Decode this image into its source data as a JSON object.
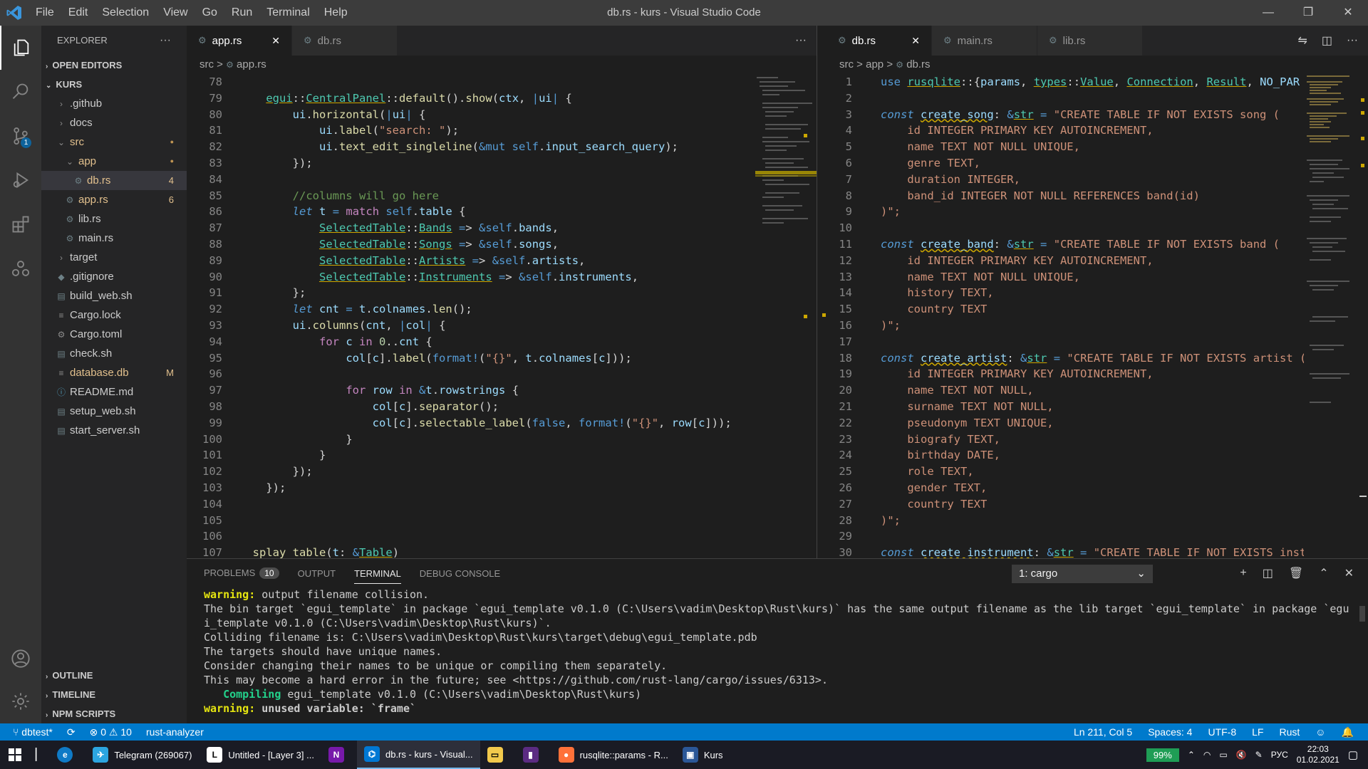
{
  "window": {
    "title": "db.rs - kurs - Visual Studio Code",
    "menu": [
      "File",
      "Edit",
      "Selection",
      "View",
      "Go",
      "Run",
      "Terminal",
      "Help"
    ],
    "controls": [
      "—",
      "❐",
      "✕"
    ]
  },
  "activity": {
    "scm_badge": "1"
  },
  "explorer": {
    "header": "EXPLORER",
    "more": "···",
    "sections": {
      "open_editors": "OPEN EDITORS",
      "root": "KURS",
      "outline": "OUTLINE",
      "timeline": "TIMELINE",
      "npm": "NPM SCRIPTS"
    },
    "items": [
      {
        "label": ".github",
        "indent": 1,
        "type": "folder-closed"
      },
      {
        "label": "docs",
        "indent": 1,
        "type": "folder-closed"
      },
      {
        "label": "src",
        "indent": 1,
        "type": "folder-open",
        "decoration": "●"
      },
      {
        "label": "app",
        "indent": 2,
        "type": "folder-open",
        "decoration": "●"
      },
      {
        "label": "db.rs",
        "indent": 3,
        "type": "rust",
        "decoration": "4",
        "selected": true
      },
      {
        "label": "app.rs",
        "indent": 2,
        "type": "rust",
        "decoration": "6"
      },
      {
        "label": "lib.rs",
        "indent": 2,
        "type": "rust"
      },
      {
        "label": "main.rs",
        "indent": 2,
        "type": "rust"
      },
      {
        "label": "target",
        "indent": 1,
        "type": "folder-closed"
      },
      {
        "label": ".gitignore",
        "indent": 1,
        "type": "git"
      },
      {
        "label": "build_web.sh",
        "indent": 1,
        "type": "file"
      },
      {
        "label": "Cargo.lock",
        "indent": 1,
        "type": "lines"
      },
      {
        "label": "Cargo.toml",
        "indent": 1,
        "type": "gear"
      },
      {
        "label": "check.sh",
        "indent": 1,
        "type": "file"
      },
      {
        "label": "database.db",
        "indent": 1,
        "type": "lines",
        "decoration": "M"
      },
      {
        "label": "README.md",
        "indent": 1,
        "type": "info"
      },
      {
        "label": "setup_web.sh",
        "indent": 1,
        "type": "file"
      },
      {
        "label": "start_server.sh",
        "indent": 1,
        "type": "file"
      }
    ]
  },
  "editor_left": {
    "tabs": [
      {
        "label": "app.rs",
        "close": "✕",
        "active": true
      },
      {
        "label": "db.rs",
        "close": "",
        "active": false
      }
    ],
    "more": "···",
    "breadcrumb": {
      "a": "src",
      "sep": ">",
      "b": "app.rs"
    },
    "lines": [
      {
        "n": "78",
        "code": ""
      },
      {
        "n": "79",
        "code": "    egui::CentralPanel::default().show(ctx, |ui| {"
      },
      {
        "n": "80",
        "code": "        ui.horizontal(|ui| {"
      },
      {
        "n": "81",
        "code": "            ui.label(\"search: \");"
      },
      {
        "n": "82",
        "code": "            ui.text_edit_singleline(&mut self.input_search_query);"
      },
      {
        "n": "83",
        "code": "        });"
      },
      {
        "n": "84",
        "code": ""
      },
      {
        "n": "85",
        "code": "        //columns will go here"
      },
      {
        "n": "86",
        "code": "        let t = match self.table {"
      },
      {
        "n": "87",
        "code": "            SelectedTable::Bands => &self.bands,"
      },
      {
        "n": "88",
        "code": "            SelectedTable::Songs => &self.songs,"
      },
      {
        "n": "89",
        "code": "            SelectedTable::Artists => &self.artists,"
      },
      {
        "n": "90",
        "code": "            SelectedTable::Instruments => &self.instruments,"
      },
      {
        "n": "91",
        "code": "        };"
      },
      {
        "n": "92",
        "code": "        let cnt = t.colnames.len();"
      },
      {
        "n": "93",
        "code": "        ui.columns(cnt, |col| {"
      },
      {
        "n": "94",
        "code": "            for c in 0..cnt {"
      },
      {
        "n": "95",
        "code": "                col[c].label(format!(\"{}\", t.colnames[c]));"
      },
      {
        "n": "96",
        "code": ""
      },
      {
        "n": "97",
        "code": "                for row in &t.rowstrings {"
      },
      {
        "n": "98",
        "code": "                    col[c].separator();"
      },
      {
        "n": "99",
        "code": "                    col[c].selectable_label(false, format!(\"{}\", row[c]));"
      },
      {
        "n": "100",
        "code": "                }"
      },
      {
        "n": "101",
        "code": "            }"
      },
      {
        "n": "102",
        "code": "        });"
      },
      {
        "n": "103",
        "code": "    });"
      },
      {
        "n": "104",
        "code": ""
      },
      {
        "n": "105",
        "code": ""
      },
      {
        "n": "106",
        "code": ""
      },
      {
        "n": "107",
        "code": "  splay_table(t: &Table)"
      }
    ]
  },
  "editor_right": {
    "tabs": [
      {
        "label": "db.rs",
        "close": "✕",
        "active": true
      },
      {
        "label": "main.rs",
        "close": "",
        "active": false
      },
      {
        "label": "lib.rs",
        "close": "",
        "active": false
      }
    ],
    "breadcrumb": {
      "a": "src",
      "sep": ">",
      "b": "app",
      "c": "db.rs"
    },
    "lines": [
      {
        "n": "1",
        "code": "use rusqlite::{params, types::Value, Connection, Result, NO_PAR"
      },
      {
        "n": "2",
        "code": ""
      },
      {
        "n": "3",
        "code": "const create_song: &str = \"CREATE TABLE IF NOT EXISTS song ("
      },
      {
        "n": "4",
        "code": "    id INTEGER PRIMARY KEY AUTOINCREMENT,"
      },
      {
        "n": "5",
        "code": "    name TEXT NOT NULL UNIQUE,"
      },
      {
        "n": "6",
        "code": "    genre TEXT,"
      },
      {
        "n": "7",
        "code": "    duration INTEGER,"
      },
      {
        "n": "8",
        "code": "    band_id INTEGER NOT NULL REFERENCES band(id)"
      },
      {
        "n": "9",
        "code": ")\";"
      },
      {
        "n": "10",
        "code": ""
      },
      {
        "n": "11",
        "code": "const create_band: &str = \"CREATE TABLE IF NOT EXISTS band ("
      },
      {
        "n": "12",
        "code": "    id INTEGER PRIMARY KEY AUTOINCREMENT,"
      },
      {
        "n": "13",
        "code": "    name TEXT NOT NULL UNIQUE,"
      },
      {
        "n": "14",
        "code": "    history TEXT,"
      },
      {
        "n": "15",
        "code": "    country TEXT"
      },
      {
        "n": "16",
        "code": ")\";"
      },
      {
        "n": "17",
        "code": ""
      },
      {
        "n": "18",
        "code": "const create_artist: &str = \"CREATE TABLE IF NOT EXISTS artist ("
      },
      {
        "n": "19",
        "code": "    id INTEGER PRIMARY KEY AUTOINCREMENT,"
      },
      {
        "n": "20",
        "code": "    name TEXT NOT NULL,"
      },
      {
        "n": "21",
        "code": "    surname TEXT NOT NULL,"
      },
      {
        "n": "22",
        "code": "    pseudonym TEXT UNIQUE,"
      },
      {
        "n": "23",
        "code": "    biografy TEXT,"
      },
      {
        "n": "24",
        "code": "    birthday DATE,"
      },
      {
        "n": "25",
        "code": "    role TEXT,"
      },
      {
        "n": "26",
        "code": "    gender TEXT,"
      },
      {
        "n": "27",
        "code": "    country TEXT"
      },
      {
        "n": "28",
        "code": ")\";"
      },
      {
        "n": "29",
        "code": ""
      },
      {
        "n": "30",
        "code": "const create_instrument: &str = \"CREATE TABLE IF NOT EXISTS inst"
      }
    ]
  },
  "panel": {
    "tabs": [
      "PROBLEMS",
      "OUTPUT",
      "TERMINAL",
      "DEBUG CONSOLE"
    ],
    "problems_count": "10",
    "terminal_select": "1: cargo",
    "actions": [
      "+",
      "◫",
      "🗑",
      "⌃",
      "✕"
    ],
    "terminal_lines": [
      {
        "prefix": "warning:",
        "text": " output filename collision."
      },
      {
        "prefix": "",
        "text": "The bin target `egui_template` in package `egui_template v0.1.0 (C:\\Users\\vadim\\Desktop\\Rust\\kurs)` has the same output filename as the lib target `egui_template` in package `egu"
      },
      {
        "prefix": "",
        "text": "i_template v0.1.0 (C:\\Users\\vadim\\Desktop\\Rust\\kurs)`."
      },
      {
        "prefix": "",
        "text": "Colliding filename is: C:\\Users\\vadim\\Desktop\\Rust\\kurs\\target\\debug\\egui_template.pdb"
      },
      {
        "prefix": "",
        "text": "The targets should have unique names."
      },
      {
        "prefix": "",
        "text": "Consider changing their names to be unique or compiling them separately."
      },
      {
        "prefix": "",
        "text": "This may become a hard error in the future; see <https://github.com/rust-lang/cargo/issues/6313>."
      },
      {
        "prefix": "   Compiling",
        "text": " egui_template v0.1.0 (C:\\Users\\vadim\\Desktop\\Rust\\kurs)"
      },
      {
        "prefix": "warning:",
        "text": " unused variable: `frame`"
      }
    ]
  },
  "status": {
    "branch": "dbtest*",
    "sync": "⟳",
    "errors": "⊗ 0",
    "warnings": "⚠ 10",
    "analyzer": "rust-analyzer",
    "position": "Ln 211, Col 5",
    "spaces": "Spaces: 4",
    "encoding": "UTF-8",
    "eol": "LF",
    "language": "Rust"
  },
  "taskbar": {
    "items": [
      {
        "label": "Telegram (269067)",
        "color": "#2ca5e0",
        "glyph": "✈"
      },
      {
        "label": "Untitled - [Layer 3] ...",
        "color": "#ffffff",
        "glyph": "L"
      },
      {
        "label": "",
        "color": "#7719aa",
        "glyph": "N"
      },
      {
        "label": "db.rs - kurs - Visual...",
        "color": "#0078d4",
        "glyph": "⌬",
        "active": true
      },
      {
        "label": "",
        "color": "#f2c94c",
        "glyph": "▭"
      },
      {
        "label": "",
        "color": "#5b2b82",
        "glyph": "▮"
      },
      {
        "label": "rusqlite::params - R...",
        "color": "#ff7139",
        "glyph": "●"
      },
      {
        "label": "Kurs",
        "color": "#2b5797",
        "glyph": "▣"
      }
    ],
    "battery": "99%",
    "lang": "РУС",
    "time": "22:03",
    "date": "01.02.2021"
  }
}
